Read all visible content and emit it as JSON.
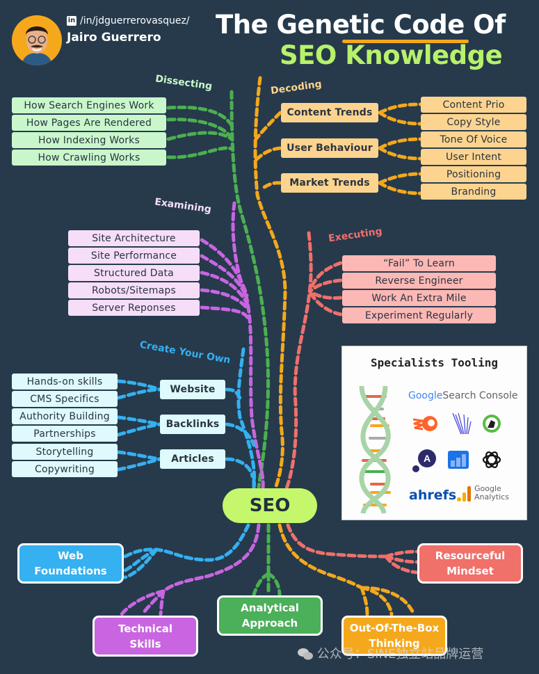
{
  "header": {
    "linkedin_handle": "/in/jdguerrerovasquez/",
    "author_name": "Jairo Guerrero",
    "title_line1": "The Genetic Code Of",
    "title_line2": "SEO Knowledge"
  },
  "colors": {
    "background": "#263a4c",
    "green": "#4caf50",
    "orange": "#f5a81c",
    "purple": "#c965e0",
    "salmon": "#f0706a",
    "blue": "#35b0f0",
    "seo_hub": "#c4f76b",
    "title_accent": "#b7f26a"
  },
  "branches": {
    "dissecting": {
      "label": "Dissecting",
      "items": [
        "How Search Engines Work",
        "How Pages Are Rendered",
        "How Indexing Works",
        "How Crawling Works"
      ]
    },
    "decoding": {
      "label": "Decoding",
      "groups": [
        {
          "hub": "Content Trends",
          "items": [
            "Content Prio",
            "Copy Style"
          ]
        },
        {
          "hub": "User Behaviour",
          "items": [
            "Tone Of Voice",
            "User Intent"
          ]
        },
        {
          "hub": "Market Trends",
          "items": [
            "Positioning",
            "Branding"
          ]
        }
      ]
    },
    "examining": {
      "label": "Examining",
      "items": [
        "Site Architecture",
        "Site Performance",
        "Structured Data",
        "Robots/Sitemaps",
        "Server Reponses"
      ]
    },
    "executing": {
      "label": "Executing",
      "items": [
        "“Fail” To Learn",
        "Reverse Engineer",
        "Work An Extra Mile",
        "Experiment Regularly"
      ]
    },
    "create_your_own": {
      "label": "Create Your Own",
      "groups": [
        {
          "hub": "Website",
          "items": [
            "Hands-on skills",
            "CMS Specifics"
          ]
        },
        {
          "hub": "Backlinks",
          "items": [
            "Authority Building",
            "Partnerships"
          ]
        },
        {
          "hub": "Articles",
          "items": [
            "Storytelling",
            "Copywriting"
          ]
        }
      ]
    }
  },
  "center": {
    "label": "SEO"
  },
  "roots": [
    {
      "line1": "Web",
      "line2": "Foundations"
    },
    {
      "line1": "Technical",
      "line2": "Skills"
    },
    {
      "line1": "Analytical",
      "line2": "Approach"
    },
    {
      "line1": "Out-Of-The-Box",
      "line2": "Thinking"
    },
    {
      "line1": "Resourceful",
      "line2": "Mindset"
    }
  ],
  "tooling": {
    "title": "Specialists Tooling",
    "tools": [
      "Google Search Console",
      "Semrush",
      "Screaming Frog",
      "Ahrefs",
      "Google Analytics",
      "ChatGPT"
    ],
    "gsc_google": "Google",
    "gsc_rest": "Search Console",
    "ahrefs": "ahrefs",
    "ga_line1": "Google",
    "ga_line2": "Analytics"
  },
  "watermark": "公众号：SINE独立站品牌运营"
}
